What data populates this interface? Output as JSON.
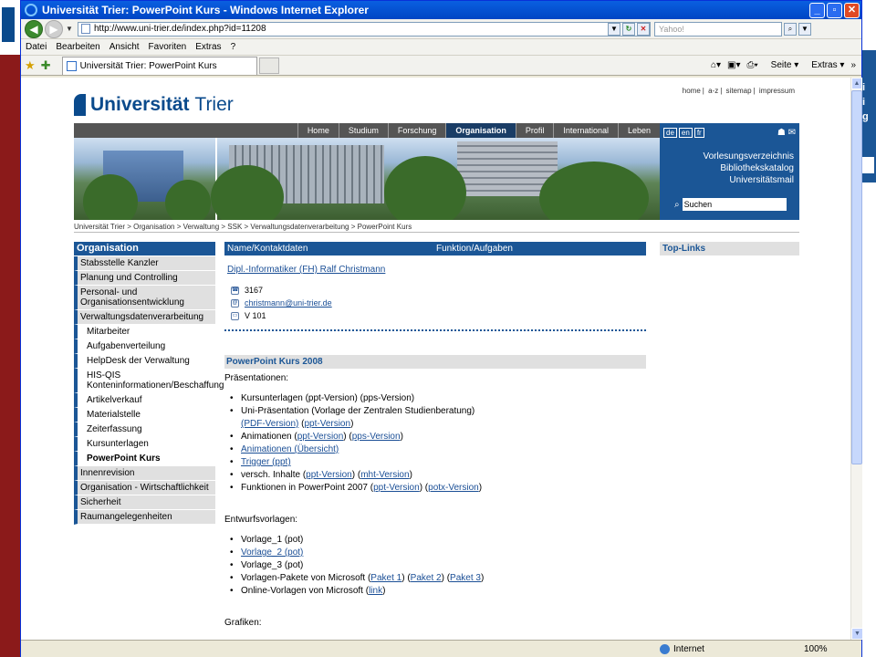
{
  "window": {
    "title": "Universität Trier: PowerPoint Kurs - Windows Internet Explorer",
    "minimize": "_",
    "maximize": "▫",
    "close": "✕"
  },
  "address": {
    "url": "http://www.uni-trier.de/index.php?id=11208",
    "search_placeholder": "Yahoo!"
  },
  "menu": [
    "Datei",
    "Bearbeiten",
    "Ansicht",
    "Favoriten",
    "Extras",
    "?"
  ],
  "tab": {
    "label": "Universität Trier: PowerPoint Kurs"
  },
  "commands": {
    "seite": "Seite",
    "extras": "Extras"
  },
  "site": {
    "toplinks": [
      "home",
      "a-z",
      "sitemap",
      "impressum"
    ],
    "logo_bold": "Universität",
    "logo_rest": "Trier",
    "nav": [
      "Home",
      "Studium",
      "Forschung",
      "Organisation",
      "Profil",
      "International",
      "Leben"
    ],
    "nav_active": "Organisation",
    "langs": [
      "de",
      "en",
      "fr"
    ],
    "quick": [
      "Vorlesungsverzeichnis",
      "Bibliothekskatalog",
      "Universitätsmail"
    ],
    "search_value": "Suchen",
    "breadcrumb": "Universität Trier > Organisation > Verwaltung > SSK > Verwaltungsdatenverarbeitung > PowerPoint Kurs"
  },
  "sidebar": {
    "head": "Organisation",
    "items": [
      {
        "label": "Stabsstelle Kanzler",
        "type": "item"
      },
      {
        "label": "Planung und Controlling",
        "type": "item"
      },
      {
        "label": "Personal- und Organisationsentwicklung",
        "type": "item"
      },
      {
        "label": "Verwaltungsdatenverarbeitung",
        "type": "item"
      },
      {
        "label": "Mitarbeiter",
        "type": "sub"
      },
      {
        "label": "Aufgabenverteilung",
        "type": "sub"
      },
      {
        "label": "HelpDesk der Verwaltung",
        "type": "sub"
      },
      {
        "label": "HIS-QIS Konteninformationen/Beschaffung",
        "type": "sub"
      },
      {
        "label": "Artikelverkauf",
        "type": "sub"
      },
      {
        "label": "Materialstelle",
        "type": "sub"
      },
      {
        "label": "Zeiterfassung",
        "type": "sub"
      },
      {
        "label": "Kursunterlagen",
        "type": "sub"
      },
      {
        "label": "PowerPoint Kurs",
        "type": "sub",
        "current": true
      },
      {
        "label": "Innenrevision",
        "type": "item"
      },
      {
        "label": "Organisation - Wirtschaftlichkeit",
        "type": "item"
      },
      {
        "label": "Sicherheit",
        "type": "item"
      },
      {
        "label": "Raumangelegenheiten",
        "type": "item"
      }
    ]
  },
  "contact": {
    "col1": "Name/Kontaktdaten",
    "col2": "Funktion/Aufgaben",
    "name": "Dipl.-Informatiker (FH) Ralf Christmann",
    "phone": "3167",
    "email": "christmann@uni-trier.de",
    "room": "V 101"
  },
  "course": {
    "heading": "PowerPoint Kurs 2008",
    "praesentationen_title": "Präsentationen:",
    "entwurf_title": "Entwurfsvorlagen:",
    "grafiken_title": "Grafiken:"
  },
  "right": {
    "head": "Top-Links"
  },
  "status": {
    "zone": "Internet",
    "zoom": "100%"
  }
}
